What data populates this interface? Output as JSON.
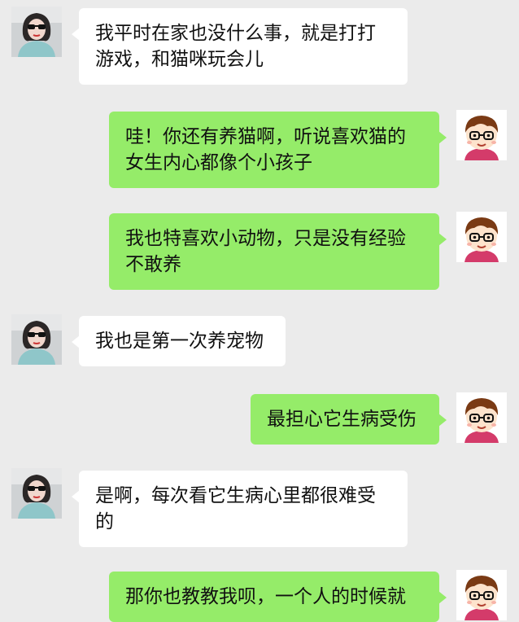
{
  "colors": {
    "background": "#ebebeb",
    "incoming_bubble": "#ffffff",
    "outgoing_bubble": "#95ec69"
  },
  "messages": [
    {
      "side": "left",
      "avatar": "woman-avatar",
      "text": "我平时在家也没什么事，就是打打游戏，和猫咪玩会儿"
    },
    {
      "side": "right",
      "avatar": "cartoon-boy-avatar",
      "text": "哇！你还有养猫啊，听说喜欢猫的女生内心都像个小孩子"
    },
    {
      "side": "right",
      "avatar": "cartoon-boy-avatar",
      "text": "我也特喜欢小动物，只是没有经验不敢养"
    },
    {
      "side": "left",
      "avatar": "woman-avatar",
      "text": "我也是第一次养宠物"
    },
    {
      "side": "right",
      "avatar": "cartoon-boy-avatar",
      "text": "最担心它生病受伤"
    },
    {
      "side": "left",
      "avatar": "woman-avatar",
      "text": "是啊，每次看它生病心里都很难受的"
    },
    {
      "side": "right",
      "avatar": "cartoon-boy-avatar",
      "text": "那你也教教我呗，一个人的时候就"
    }
  ]
}
